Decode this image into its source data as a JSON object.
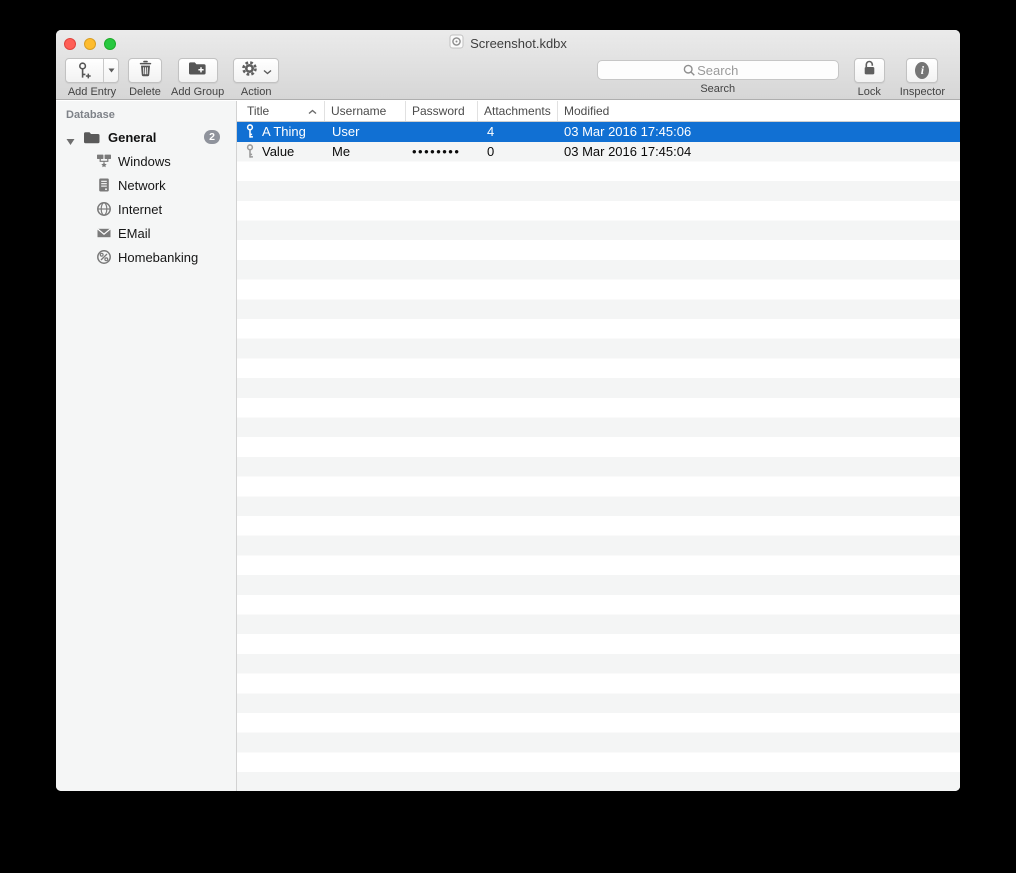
{
  "window": {
    "title": "Screenshot.kdbx",
    "controls": [
      "close",
      "minimize",
      "zoom"
    ]
  },
  "toolbar": {
    "add_entry_label": "Add Entry",
    "delete_label": "Delete",
    "add_group_label": "Add Group",
    "action_label": "Action",
    "search_label": "Search",
    "search_placeholder": "Search",
    "search_value": "",
    "lock_label": "Lock",
    "inspector_label": "Inspector",
    "inspector_glyph": "i",
    "icons": [
      "key-plus-icon",
      "dropdown-arrow-icon",
      "trash-icon",
      "folder-plus-icon",
      "gear-icon",
      "chevron-down-icon",
      "magnifier-icon",
      "padlock-open-icon",
      "info-icon"
    ]
  },
  "sidebar": {
    "header": "Database",
    "root": {
      "label": "General",
      "badge": "2",
      "icon": "folder-icon",
      "expanded": true
    },
    "items": [
      {
        "label": "Windows",
        "icon": "windows-group-icon"
      },
      {
        "label": "Network",
        "icon": "network-icon"
      },
      {
        "label": "Internet",
        "icon": "globe-icon"
      },
      {
        "label": "EMail",
        "icon": "envelope-icon"
      },
      {
        "label": "Homebanking",
        "icon": "percent-coin-icon"
      }
    ]
  },
  "table": {
    "columns": [
      "Title",
      "Username",
      "Password",
      "Attachments",
      "Modified"
    ],
    "sort": {
      "column": "Title",
      "direction": "ascending"
    },
    "row_icon": "key-icon",
    "rows": [
      {
        "title": "A Thing",
        "username": "User",
        "password": "",
        "attachments": "4",
        "modified": "03 Mar 2016 17:45:06",
        "selected": true
      },
      {
        "title": "Value",
        "username": "Me",
        "password": "••••••••",
        "attachments": "0",
        "modified": "03 Mar 2016 17:45:04",
        "selected": false
      }
    ]
  },
  "colors": {
    "selection_blue": "#1170d3",
    "stripe_gray": "#f4f5f5",
    "toolbar_top": "#ebebeb",
    "toolbar_bottom": "#d6d6d6",
    "traffic_red": "#ff5f57",
    "traffic_yellow": "#febc2e",
    "traffic_green": "#28c840"
  }
}
